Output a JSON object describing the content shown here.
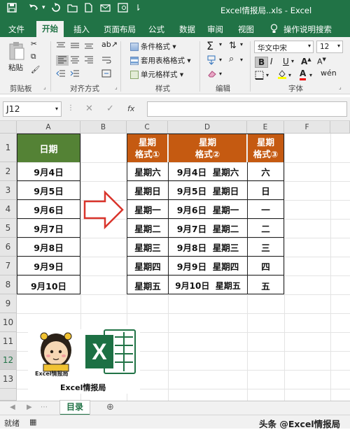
{
  "quick_access": {
    "save_icon": "save-icon",
    "undo_icon": "undo-icon",
    "redo_icon": "redo-icon",
    "title": "Excel情报局..xls  -  Excel"
  },
  "tabs": [
    "文件",
    "开始",
    "插入",
    "页面布局",
    "公式",
    "数据",
    "审阅",
    "视图"
  ],
  "active_tab": "开始",
  "tell_me": "操作说明搜索",
  "ribbon": {
    "paste_label": "粘贴",
    "cond_format": "条件格式",
    "table_format": "套用表格格式",
    "cell_style": "单元格样式",
    "font_name": "华文中宋",
    "font_size": "12",
    "group_clipboard": "剪贴板",
    "group_align": "对齐方式",
    "group_style": "样式",
    "group_edit": "编辑",
    "group_font": "字体",
    "bold": "B",
    "italic": "I",
    "underline": "U"
  },
  "formula_bar": {
    "name_box": "J12",
    "fx": "fx",
    "content": ""
  },
  "columns": [
    "A",
    "B",
    "C",
    "D",
    "E",
    "F"
  ],
  "rows": [
    "1",
    "2",
    "3",
    "4",
    "5",
    "6",
    "7",
    "8",
    "9",
    "10",
    "11",
    "12",
    "13"
  ],
  "left_table": {
    "header": "日期",
    "dates": [
      "9月4日",
      "9月5日",
      "9月6日",
      "9月7日",
      "9月8日",
      "9月9日",
      "9月10日"
    ]
  },
  "right_table": {
    "headers": [
      "星期\n格式①",
      "星期\n格式②",
      "星期\n格式③"
    ],
    "fmt1": [
      "星期六",
      "星期日",
      "星期一",
      "星期二",
      "星期三",
      "星期四",
      "星期五"
    ],
    "fmt2": [
      "9月4日  星期六",
      "9月5日  星期日",
      "9月6日  星期一",
      "9月7日  星期二",
      "9月8日  星期三",
      "9月9日  星期四",
      "9月10日  星期五"
    ],
    "fmt3": [
      "六",
      "日",
      "一",
      "二",
      "三",
      "四",
      "五"
    ]
  },
  "logo": {
    "text_small": "Excel情报局",
    "caption": "Excel情报局",
    "excel_letter": "X"
  },
  "colors": {
    "accent": "#217346",
    "header_green": "#548235",
    "header_orange": "#c55a11",
    "arrow": "#d9342b"
  },
  "sheet_tab": "目录",
  "status": {
    "ready": "就绪",
    "watermark": "头条 @Excel情报局"
  }
}
